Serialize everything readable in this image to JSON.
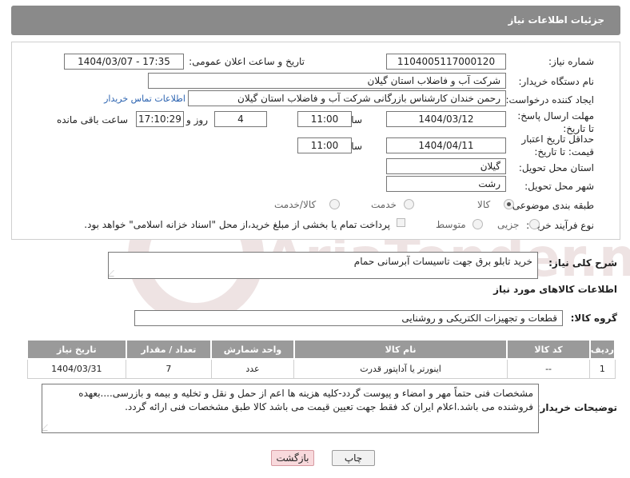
{
  "header": {
    "title": "جزئیات اطلاعات نیاز"
  },
  "form": {
    "need_number_label": "شماره نیاز:",
    "need_number": "1104005117000120",
    "announce_label": "تاریخ و ساعت اعلان عمومی:",
    "announce_value": "1404/03/07 - 17:35",
    "buyer_org_label": "نام دستگاه خریدار:",
    "buyer_org": "شرکت آب و فاضلاب استان گیلان",
    "creator_label": "ایجاد کننده درخواست:",
    "creator": "رحمن خندان کارشناس بازرگانی شرکت آب و فاضلاب استان گیلان",
    "contact_link": "اطلاعات تماس خریدار",
    "deadline_label": "مهلت ارسال پاسخ: تا تاریخ:",
    "deadline_date": "1404/03/12",
    "time_label": "ساعت",
    "deadline_time": "11:00",
    "days_value": "4",
    "days_label": "روز و",
    "remaining_time": "17:10:29",
    "remaining_label": "ساعت باقی مانده",
    "validity_label": "حداقل تاریخ اعتبار قیمت: تا تاریخ:",
    "validity_date": "1404/04/11",
    "validity_time": "11:00",
    "province_label": "استان محل تحویل:",
    "province": "گیلان",
    "city_label": "شهر محل تحویل:",
    "city": "رشت",
    "category_label": "طبقه بندی موضوعی:",
    "category_options": [
      "کالا",
      "خدمت",
      "کالا/خدمت"
    ],
    "process_label": "نوع فرآیند خرید :",
    "process_options": [
      "جزیی",
      "متوسط"
    ],
    "payment_note": "پرداخت تمام یا بخشی از مبلغ خرید،از محل \"اسناد خزانه اسلامی\" خواهد بود."
  },
  "summary": {
    "label": "شرح کلی نیاز:",
    "text": "خرید تابلو برق جهت تاسیسات آبرسانی حمام"
  },
  "goods": {
    "section_title": "اطلاعات کالاهای مورد نیاز",
    "group_label": "گروه کالا:",
    "group_value": "قطعات و تجهیزات الکتریکی و روشنایی",
    "columns": [
      "ردیف",
      "کد کالا",
      "نام کالا",
      "واحد شمارش",
      "تعداد / مقدار",
      "تاریخ نیاز"
    ],
    "rows": [
      [
        "1",
        "--",
        "اینورتر یا آداپتور قدرت",
        "عدد",
        "7",
        "1404/03/31"
      ]
    ]
  },
  "buyer_notes": {
    "label": "توضیحات خریدار:",
    "text": "مشخصات فنی حتماً مهر و امضاء و پیوست گردد-کلیه هزینه ها اعم از حمل و نقل و تخلیه و بیمه و بازرسی....بعهده فروشنده می باشد.اعلام ایران کد فقط جهت تعیین قیمت می باشد کالا طبق مشخصات فنی ارائه گردد."
  },
  "buttons": {
    "print": "چاپ",
    "back": "بازگشت"
  },
  "watermark": {
    "text": "AriaTender.neT"
  }
}
